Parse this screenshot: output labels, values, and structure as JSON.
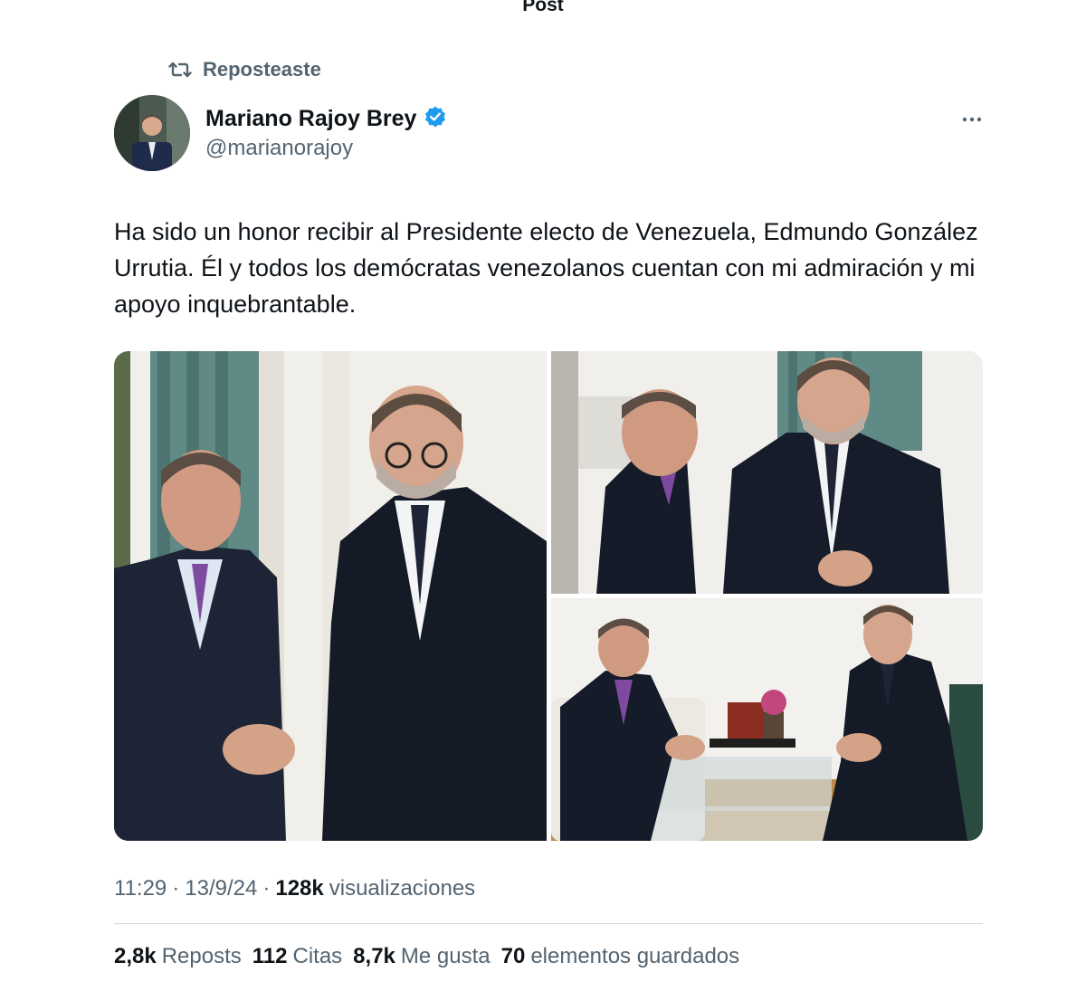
{
  "header": {
    "title": "Post"
  },
  "repost": {
    "label": "Reposteaste",
    "icon": "repost-icon"
  },
  "author": {
    "name": "Mariano Rajoy Brey",
    "handle": "@marianorajoy",
    "verified": true,
    "verified_color": "#1d9bf0"
  },
  "post": {
    "text": "Ha sido un honor recibir al Presidente electo de Venezuela, Edmundo González Urrutia. Él y todos los demócratas venezolanos cuentan con mi admiración y mi apoyo inquebrantable.",
    "media_count": 3
  },
  "meta": {
    "time": "11:29",
    "sep1": "·",
    "date": "13/9/24",
    "sep2": "·",
    "views_count": "128k",
    "views_label": "visualizaciones"
  },
  "stats": {
    "reposts_count": "2,8k",
    "reposts_label": "Reposts",
    "quotes_count": "112",
    "quotes_label": "Citas",
    "likes_count": "8,7k",
    "likes_label": "Me gusta",
    "bookmarks_count": "70",
    "bookmarks_label": "elementos guardados"
  },
  "colors": {
    "text_primary": "#0f1419",
    "text_secondary": "#536471",
    "accent": "#1d9bf0",
    "divider": "#cfd9de"
  }
}
